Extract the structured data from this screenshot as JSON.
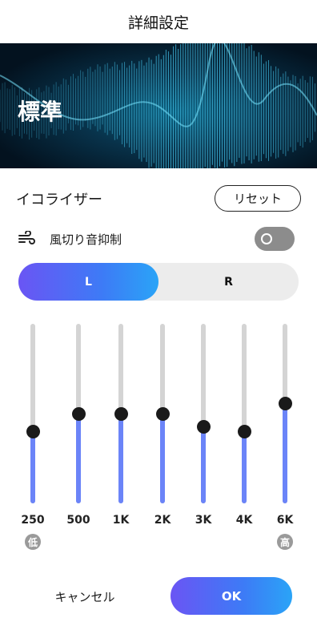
{
  "header": {
    "title": "詳細設定"
  },
  "banner": {
    "preset_name": "標準"
  },
  "equalizer": {
    "title": "イコライザー",
    "reset_label": "リセット",
    "wind_noise": {
      "label": "風切り音抑制",
      "enabled": false,
      "icon": "wind-icon"
    },
    "channels": {
      "left_label": "L",
      "right_label": "R",
      "selected": "L"
    },
    "bands": [
      {
        "label": "250",
        "level": 0.4,
        "badge": "低"
      },
      {
        "label": "500",
        "level": 0.5,
        "badge": ""
      },
      {
        "label": "1K",
        "level": 0.5,
        "badge": ""
      },
      {
        "label": "2K",
        "level": 0.5,
        "badge": ""
      },
      {
        "label": "3K",
        "level": 0.43,
        "badge": ""
      },
      {
        "label": "4K",
        "level": 0.4,
        "badge": ""
      },
      {
        "label": "6K",
        "level": 0.56,
        "badge": "高"
      }
    ]
  },
  "footer": {
    "cancel_label": "キャンセル",
    "ok_label": "OK"
  },
  "colors": {
    "accent_start": "#6a55f4",
    "accent_end": "#2aa4f7",
    "slider_fill": "#6b84f8",
    "track": "#d4d4d4"
  }
}
